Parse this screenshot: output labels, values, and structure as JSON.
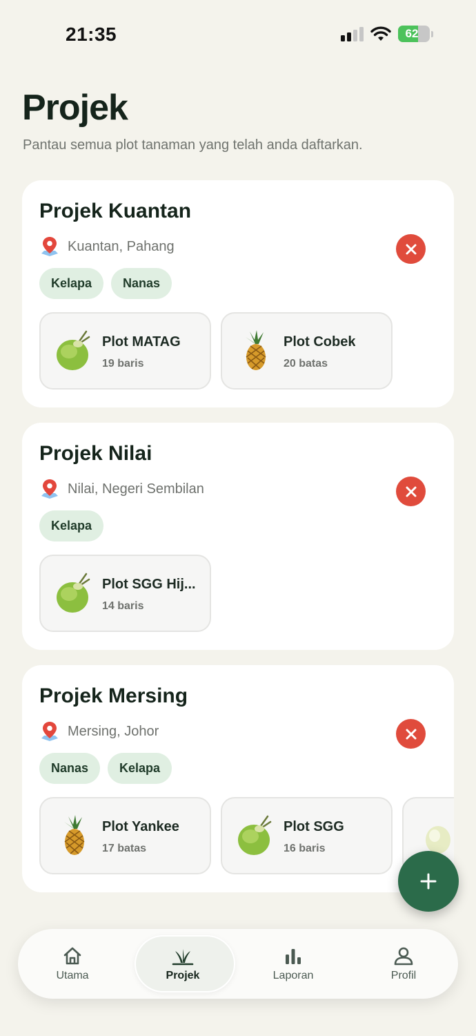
{
  "status_bar": {
    "time": "21:35",
    "battery": "62",
    "battery_level": 0.62
  },
  "header": {
    "title": "Projek",
    "subtitle": "Pantau semua plot tanaman yang telah anda daftarkan."
  },
  "projects": [
    {
      "name": "Projek Kuantan",
      "location": "Kuantan, Pahang",
      "tags": [
        "Kelapa",
        "Nanas"
      ],
      "plots": [
        {
          "name": "Plot MATAG",
          "count": "19 baris",
          "fruit": "coconut-icon"
        },
        {
          "name": "Plot Cobek",
          "count": "20 batas",
          "fruit": "pineapple-icon"
        }
      ]
    },
    {
      "name": "Projek Nilai",
      "location": "Nilai, Negeri Sembilan",
      "tags": [
        "Kelapa"
      ],
      "plots": [
        {
          "name": "Plot SGG Hij...",
          "count": "14 baris",
          "fruit": "coconut-icon"
        }
      ]
    },
    {
      "name": "Projek Mersing",
      "location": "Mersing, Johor",
      "tags": [
        "Nanas",
        "Kelapa"
      ],
      "plots": [
        {
          "name": "Plot Yankee",
          "count": "17 batas",
          "fruit": "pineapple-icon"
        },
        {
          "name": "Plot SGG",
          "count": "16 baris",
          "fruit": "coconut-icon"
        }
      ]
    }
  ],
  "nav": [
    {
      "label": "Utama",
      "icon": "home-icon"
    },
    {
      "label": "Projek",
      "icon": "sprout-icon",
      "active": true
    },
    {
      "label": "Laporan",
      "icon": "bar-chart-icon"
    },
    {
      "label": "Profil",
      "icon": "user-icon"
    }
  ],
  "colors": {
    "background": "#f4f3ec",
    "accent": "#2b6b4a",
    "delete": "#e04b3c",
    "tag": "#e0efe2"
  }
}
